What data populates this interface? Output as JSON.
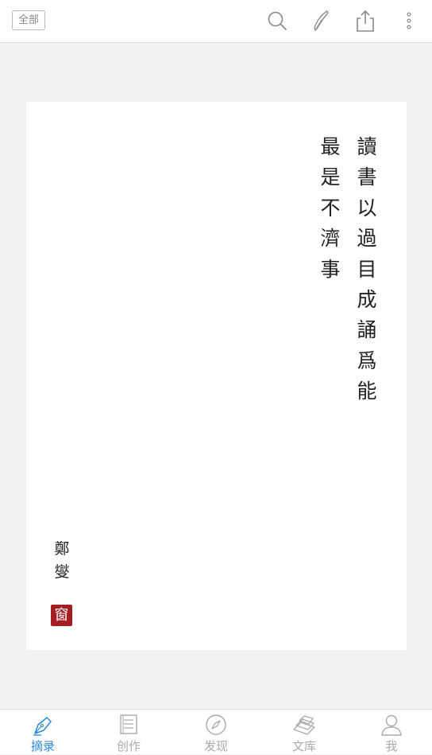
{
  "topbar": {
    "filter_label": "全部",
    "icons": [
      "search-icon",
      "pen-icon",
      "share-icon",
      "more-icon"
    ]
  },
  "card": {
    "columns": [
      [
        "讀",
        "書",
        "以",
        "過",
        "目",
        "成",
        "誦",
        "爲",
        "能"
      ],
      [
        "最",
        "是",
        "不",
        "濟",
        "事"
      ]
    ],
    "author": [
      "鄭",
      "燮"
    ],
    "seal_text": "窗"
  },
  "tabs": [
    {
      "label": "摘录",
      "icon": "pen-nib-icon",
      "active": true
    },
    {
      "label": "创作",
      "icon": "notebook-icon",
      "active": false
    },
    {
      "label": "发现",
      "icon": "compass-icon",
      "active": false
    },
    {
      "label": "文库",
      "icon": "books-icon",
      "active": false
    },
    {
      "label": "我",
      "icon": "user-icon",
      "active": false
    }
  ],
  "colors": {
    "accent": "#2a8ad8",
    "inactive": "#aaaaaa",
    "seal": "#a51d20",
    "background": "#f2f2f2"
  }
}
